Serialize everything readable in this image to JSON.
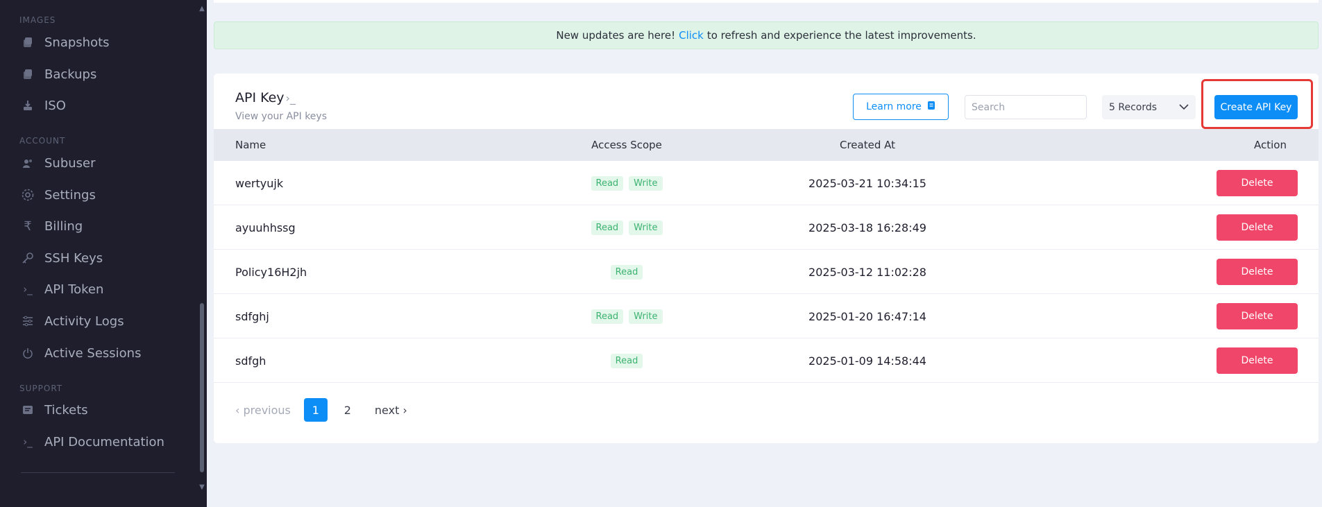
{
  "sidebar": {
    "sections": {
      "images": "IMAGES",
      "account": "ACCOUNT",
      "support": "SUPPORT"
    },
    "items": [
      {
        "label": "Snapshots",
        "icon": "snapshot-icon"
      },
      {
        "label": "Backups",
        "icon": "backup-icon"
      },
      {
        "label": "ISO",
        "icon": "iso-icon"
      },
      {
        "label": "Subuser",
        "icon": "subuser-icon"
      },
      {
        "label": "Settings",
        "icon": "gear-icon"
      },
      {
        "label": "Billing",
        "icon": "rupee-icon"
      },
      {
        "label": "SSH Keys",
        "icon": "key-icon"
      },
      {
        "label": "API Token",
        "icon": "terminal-icon"
      },
      {
        "label": "Activity Logs",
        "icon": "sliders-icon"
      },
      {
        "label": "Active Sessions",
        "icon": "power-icon"
      },
      {
        "label": "Tickets",
        "icon": "ticket-icon"
      },
      {
        "label": "API Documentation",
        "icon": "terminal-icon"
      }
    ]
  },
  "banner": {
    "before": "New updates are here!",
    "link": "Click",
    "after": "to refresh and experience the latest improvements."
  },
  "card": {
    "title": "API Key",
    "title_suffix": "›_",
    "subtitle": "View your API keys",
    "learn_more": "Learn more",
    "search_placeholder": "Search",
    "records": "5 Records",
    "create_button": "Create API Key"
  },
  "table": {
    "headers": [
      "Name",
      "Access Scope",
      "Created At",
      "Action"
    ],
    "rows": [
      {
        "name": "wertyujk",
        "scopes": [
          "Read",
          "Write"
        ],
        "created": "2025-03-21 10:34:15",
        "action": "Delete"
      },
      {
        "name": "ayuuhhssg",
        "scopes": [
          "Read",
          "Write"
        ],
        "created": "2025-03-18 16:28:49",
        "action": "Delete"
      },
      {
        "name": "Policy16H2jh",
        "scopes": [
          "Read"
        ],
        "created": "2025-03-12 11:02:28",
        "action": "Delete"
      },
      {
        "name": "sdfghj",
        "scopes": [
          "Read",
          "Write"
        ],
        "created": "2025-01-20 16:47:14",
        "action": "Delete"
      },
      {
        "name": "sdfgh",
        "scopes": [
          "Read"
        ],
        "created": "2025-01-09 14:58:44",
        "action": "Delete"
      }
    ]
  },
  "pagination": {
    "previous": "‹ previous",
    "pages": [
      "1",
      "2"
    ],
    "active": "1",
    "next": "next ›"
  },
  "colors": {
    "accent": "#0d8ef7",
    "danger": "#f0466a",
    "sidebar_bg": "#1e1e2d",
    "highlight": "#e53935"
  }
}
